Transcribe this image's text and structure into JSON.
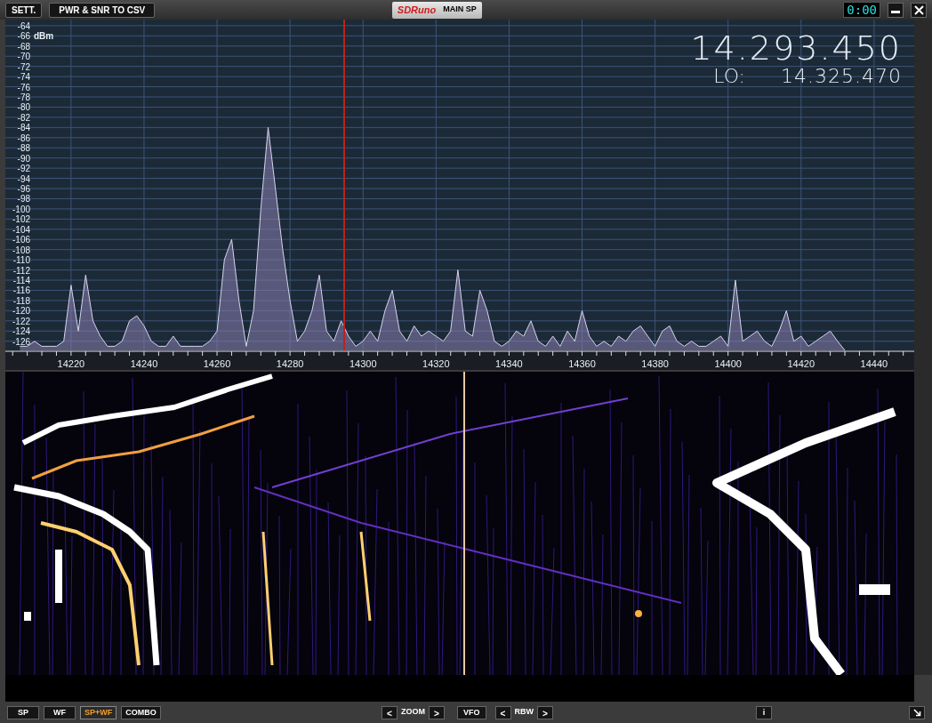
{
  "title_bar": {
    "buttons": [
      {
        "label": "SETT."
      },
      {
        "label": "PWR & SNR TO CSV"
      }
    ],
    "logo": "SDRuno",
    "panel_name": "MAIN SP",
    "clock": "0:00"
  },
  "readout": {
    "frequency": "14.293.450",
    "lo_label": "LO:",
    "lo_frequency": "14.325.470"
  },
  "spectrum": {
    "chart_data": {
      "type": "area",
      "ylabel": "dBm",
      "xlim": [
        14202,
        14451
      ],
      "ylim": [
        -127.8,
        -62.8
      ],
      "xticks": [
        14220,
        14240,
        14260,
        14280,
        14300,
        14320,
        14340,
        14360,
        14380,
        14400,
        14420,
        14440
      ],
      "yticks": [
        -64,
        -66,
        -68,
        -70,
        -72,
        -74,
        -76,
        -78,
        -80,
        -82,
        -84,
        -86,
        -88,
        -90,
        -92,
        -94,
        -96,
        -98,
        -100,
        -102,
        -104,
        -106,
        -108,
        -110,
        -112,
        -114,
        -116,
        -118,
        -120,
        -122,
        -124,
        -126
      ],
      "x": [
        14206,
        14208,
        14210,
        14212,
        14214,
        14216,
        14218,
        14220,
        14222,
        14224,
        14226,
        14228,
        14230,
        14232,
        14234,
        14236,
        14238,
        14240,
        14242,
        14244,
        14246,
        14248,
        14250,
        14252,
        14254,
        14256,
        14258,
        14260,
        14262,
        14264,
        14266,
        14268,
        14270,
        14272,
        14274,
        14276,
        14278,
        14280,
        14282,
        14284,
        14286,
        14288,
        14290,
        14292,
        14294,
        14296,
        14298,
        14300,
        14302,
        14304,
        14306,
        14308,
        14310,
        14312,
        14314,
        14316,
        14318,
        14320,
        14322,
        14324,
        14326,
        14328,
        14330,
        14332,
        14334,
        14336,
        14338,
        14340,
        14342,
        14344,
        14346,
        14348,
        14350,
        14352,
        14354,
        14356,
        14358,
        14360,
        14362,
        14364,
        14366,
        14368,
        14370,
        14372,
        14374,
        14376,
        14378,
        14380,
        14382,
        14384,
        14386,
        14388,
        14390,
        14392,
        14394,
        14396,
        14398,
        14400,
        14402,
        14404,
        14406,
        14408,
        14410,
        14412,
        14414,
        14416,
        14418,
        14420,
        14422,
        14424,
        14426,
        14428,
        14430,
        14432
      ],
      "grid": true,
      "series": [
        {
          "color": "#8a7fb0",
          "values": [
            -127,
            -127,
            -126,
            -127,
            -127,
            -127,
            -126,
            -115,
            -124,
            -113,
            -122,
            -125,
            -127,
            -127,
            -126,
            -122,
            -121,
            -123,
            -126,
            -127,
            -127,
            -125,
            -127,
            -127,
            -127,
            -127,
            -126,
            -124,
            -110,
            -106,
            -118,
            -127,
            -120,
            -100,
            -84,
            -96,
            -108,
            -118,
            -126,
            -124,
            -120,
            -113,
            -124,
            -126,
            -122,
            -125,
            -127,
            -126,
            -124,
            -126,
            -120,
            -116,
            -124,
            -126,
            -123,
            -125,
            -124,
            -125,
            -126,
            -124,
            -112,
            -124,
            -125,
            -116,
            -120,
            -126,
            -127,
            -126,
            -124,
            -125,
            -122,
            -126,
            -127,
            -125,
            -127,
            -124,
            -126,
            -120,
            -125,
            -127,
            -126,
            -127,
            -125,
            -126,
            -124,
            -123,
            -125,
            -127,
            -124,
            -123,
            -126,
            -127,
            -126,
            -127,
            -127,
            -126,
            -125,
            -127,
            -114,
            -126,
            -125,
            -124,
            -126,
            -127,
            -124,
            -120,
            -126,
            -125,
            -127,
            -126,
            -125,
            -124,
            -126,
            -127.8
          ]
        }
      ]
    }
  },
  "bottom_bar": {
    "view_buttons": [
      {
        "label": "SP",
        "selected": false
      },
      {
        "label": "WF",
        "selected": false
      },
      {
        "label": "SP+WF",
        "selected": true
      },
      {
        "label": "COMBO",
        "selected": false
      }
    ],
    "zoom_label": "ZOOM",
    "vfo_button": "VFO",
    "rbw_label": "RBW",
    "prev_symbol": "<",
    "next_symbol": ">",
    "info_button": "i"
  }
}
